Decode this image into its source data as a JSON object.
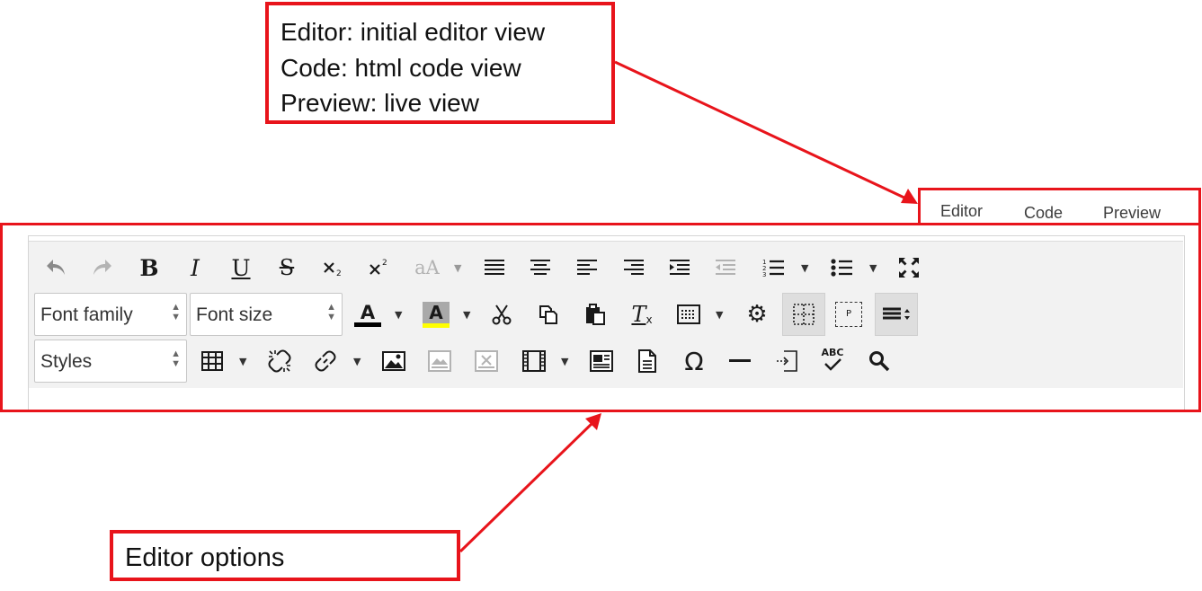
{
  "callouts": {
    "view_lines": [
      "Editor: initial editor view",
      "Code: html code view",
      "Preview: live view"
    ],
    "options_label": "Editor options"
  },
  "tabs": [
    {
      "label": "Editor"
    },
    {
      "label": "Code"
    },
    {
      "label": "Preview"
    }
  ],
  "toolbar": {
    "font_family": "Font family",
    "font_size": "Font size",
    "styles": "Styles",
    "bold": "B",
    "italic": "I",
    "underline": "U",
    "strike": "S",
    "font_color_letter": "A",
    "bg_color_letter": "A",
    "omega": "Ω",
    "paragraph": "P",
    "spellcheck": "ABC",
    "font_scale": "aA",
    "tx": "T",
    "tx_sub": "x"
  },
  "colors": {
    "callout_border": "#e8141b",
    "toolbar_bg": "#f2f2f2",
    "text_color_underline": "#000000",
    "highlight_underline": "#ffff00"
  },
  "icons": [
    "undo-icon",
    "redo-icon",
    "bold-icon",
    "italic-icon",
    "underline-icon",
    "strikethrough-icon",
    "subscript-icon",
    "superscript-icon",
    "font-scale-icon",
    "justify-icon",
    "align-center-icon",
    "align-left-icon",
    "align-right-icon",
    "indent-icon",
    "outdent-icon",
    "numbered-list-icon",
    "bullet-list-icon",
    "fullscreen-icon",
    "text-color-icon",
    "highlight-color-icon",
    "cut-icon",
    "copy-icon",
    "paste-icon",
    "clear-format-icon",
    "template-icon",
    "settings-gear-icon",
    "show-blocks-icon",
    "paragraph-icon",
    "line-height-icon",
    "table-icon",
    "unlink-icon",
    "link-icon",
    "image-icon",
    "image-disabled-icon",
    "image-remove-icon",
    "media-icon",
    "newsletter-icon",
    "document-icon",
    "omega-icon",
    "horizontal-rule-icon",
    "page-break-icon",
    "spellcheck-icon",
    "search-icon"
  ]
}
